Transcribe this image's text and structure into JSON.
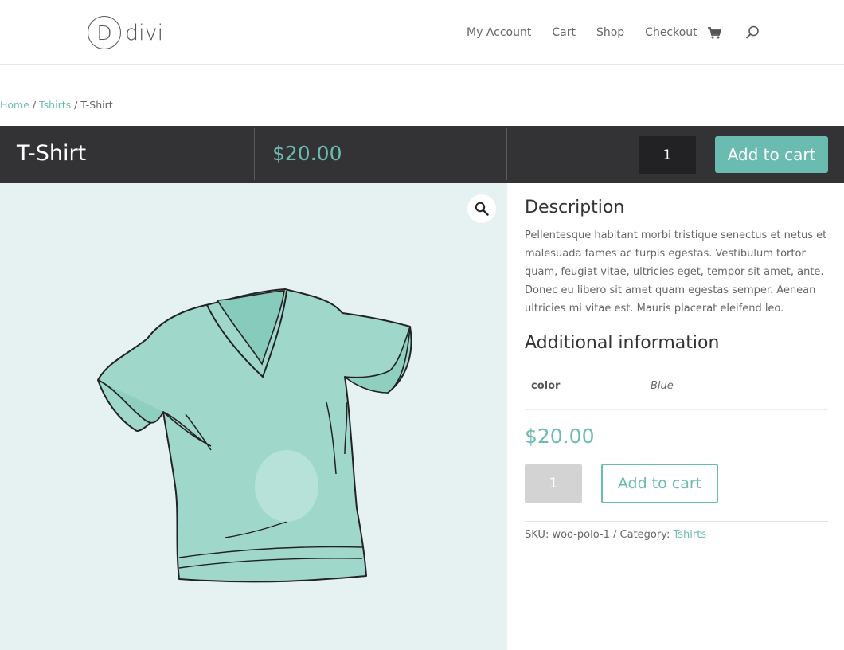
{
  "header": {
    "logo_letter": "D",
    "logo_text": "divi",
    "nav": [
      {
        "label": "My Account"
      },
      {
        "label": "Cart"
      },
      {
        "label": "Shop"
      },
      {
        "label": "Checkout"
      }
    ],
    "cart_icon": "cart-icon",
    "search_icon": "search-icon"
  },
  "breadcrumb": {
    "home": "Home",
    "sep1": " / ",
    "category": "Tshirts",
    "sep2": " / ",
    "current": "T-Shirt"
  },
  "bar": {
    "title": "T-Shirt",
    "price": "$20.00",
    "qty": "1",
    "add_label": "Add to cart"
  },
  "image": {
    "zoom_icon": "magnifier-icon"
  },
  "details": {
    "desc_heading": "Description",
    "desc_text": "Pellentesque habitant morbi tristique senectus et netus et malesuada fames ac turpis egestas. Vestibulum tortor quam, feugiat vitae, ultricies eget, tempor sit amet, ante. Donec eu libero sit amet quam egestas semper. Aenean ultricies mi vitae est. Mauris placerat eleifend leo.",
    "add_info_heading": "Additional information",
    "attr_label": "color",
    "attr_value": "Blue",
    "price": "$20.00",
    "qty": "1",
    "add_label": "Add to cart",
    "sku_text": "SKU: woo-polo-1 / Category: ",
    "category_link": "Tshirts"
  },
  "colors": {
    "accent": "#6bbcb0",
    "bar_bg": "#333336",
    "image_bg": "#e6f1f2"
  }
}
